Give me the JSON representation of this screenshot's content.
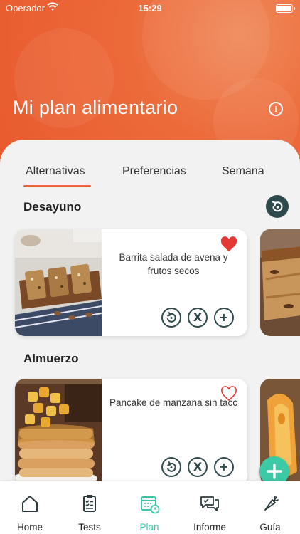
{
  "status_bar": {
    "carrier": "Operador",
    "time": "15:29"
  },
  "header": {
    "title": "Mi plan alimentario"
  },
  "tabs": [
    {
      "label": "Alternativas",
      "active": true
    },
    {
      "label": "Preferencias",
      "active": false
    },
    {
      "label": "Semana",
      "active": false
    }
  ],
  "sections": [
    {
      "title": "Desayuno",
      "card": {
        "name": "Barrita salada de avena y frutos secos",
        "favorite": true
      }
    },
    {
      "title": "Almuerzo",
      "card": {
        "name": "Pancake de manzana sin tacc",
        "favorite": false
      }
    }
  ],
  "card_actions": {
    "swap": "swap-icon",
    "remove": "X",
    "add": "+"
  },
  "bottom_nav": [
    {
      "label": "Home",
      "icon": "home-icon"
    },
    {
      "label": "Tests",
      "icon": "clipboard-icon"
    },
    {
      "label": "Plan",
      "icon": "calendar-icon",
      "active": true
    },
    {
      "label": "Informe",
      "icon": "chat-icon"
    },
    {
      "label": "Guía",
      "icon": "carrot-icon"
    }
  ],
  "colors": {
    "brand": "#e8663a",
    "accent": "#3cc9a6",
    "dark": "#2f4a4c",
    "heart": "#e53935"
  }
}
